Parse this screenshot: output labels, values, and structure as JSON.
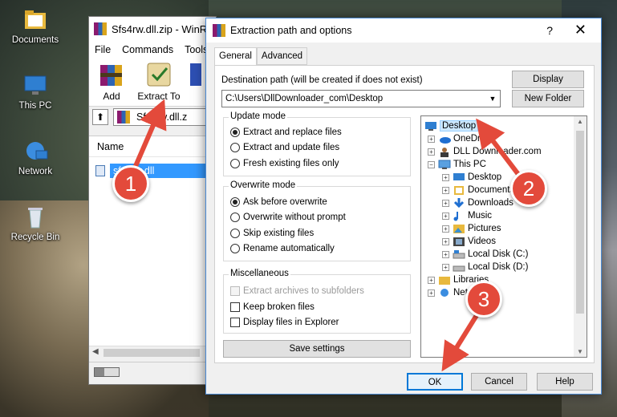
{
  "desktop": {
    "icons": [
      {
        "label": "Documents"
      },
      {
        "label": "This PC"
      },
      {
        "label": "Network"
      },
      {
        "label": "Recycle Bin"
      }
    ]
  },
  "winrar": {
    "title": "Sfs4rw.dll.zip - WinR",
    "menu": [
      "File",
      "Commands",
      "Tools"
    ],
    "toolbar": {
      "add": "Add",
      "extract_to": "Extract To"
    },
    "address": "Sfs4rw.dll.z",
    "list_header": "Name",
    "file": "sfs4rw.dll"
  },
  "dialog": {
    "title": "Extraction path and options",
    "help_glyph": "?",
    "close_glyph": "✕",
    "tabs": [
      "General",
      "Advanced"
    ],
    "dest_label": "Destination path (will be created if does not exist)",
    "dest_value": "C:\\Users\\DllDownloader_com\\Desktop",
    "display_btn": "Display",
    "new_folder_btn": "New Folder",
    "update_mode": {
      "title": "Update mode",
      "options": [
        "Extract and replace files",
        "Extract and update files",
        "Fresh existing files only"
      ],
      "selected": 0
    },
    "overwrite_mode": {
      "title": "Overwrite mode",
      "options": [
        "Ask before overwrite",
        "Overwrite without prompt",
        "Skip existing files",
        "Rename automatically"
      ],
      "selected": 0
    },
    "misc": {
      "title": "Miscellaneous",
      "options": [
        "Extract archives to subfolders",
        "Keep broken files",
        "Display files in Explorer"
      ]
    },
    "save_settings": "Save settings",
    "tree": [
      "Desktop",
      "OneDrive",
      "DLL Downloader.com",
      "This PC",
      "Desktop",
      "Documents",
      "Downloads",
      "Music",
      "Pictures",
      "Videos",
      "Local Disk (C:)",
      "Local Disk (D:)",
      "Libraries",
      "Network"
    ],
    "ok": "OK",
    "cancel": "Cancel",
    "help": "Help"
  },
  "callouts": [
    "1",
    "2",
    "3"
  ],
  "colors": {
    "callout": "#e34a3b",
    "selection": "#3399ff"
  }
}
